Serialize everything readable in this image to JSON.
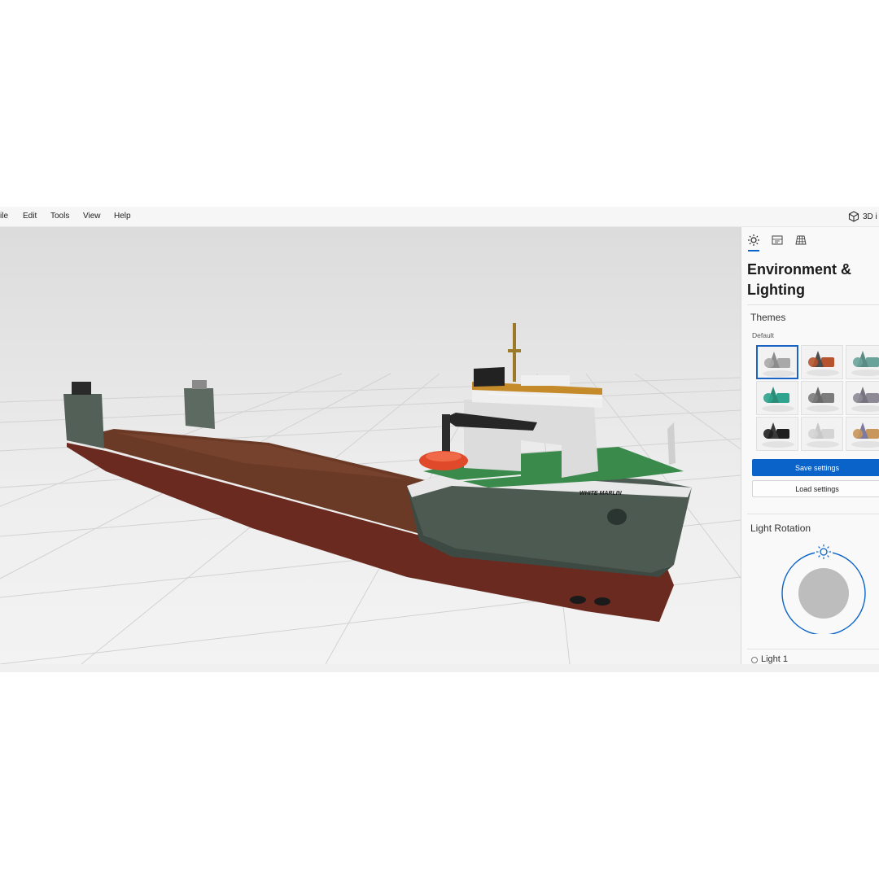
{
  "menu": {
    "items": [
      "ile",
      "Edit",
      "Tools",
      "View",
      "Help"
    ],
    "mode_label": "3D i",
    "mode_icon": "cube-icon"
  },
  "viewport": {
    "hull_name": "WHITE MARLIN"
  },
  "panel": {
    "tabs": [
      {
        "icon": "sun-icon",
        "selected": true
      },
      {
        "icon": "stats-icon",
        "selected": false
      },
      {
        "icon": "grid-icon",
        "selected": false
      }
    ],
    "title": "Environment & Lighting",
    "themes": {
      "heading": "Themes",
      "sublabel": "Default",
      "selected_index": 0,
      "tiles": [
        {
          "bg": "#f2f2f2",
          "shape": "#a9a9a9",
          "accent": "#8c8c8c"
        },
        {
          "bg": "#f2f2f2",
          "shape": "#b5542f",
          "accent": "#4c4c4c"
        },
        {
          "bg": "#f2f2f2",
          "shape": "#6aa39a",
          "accent": "#5a8c84"
        },
        {
          "bg": "#f2f2f2",
          "shape": "#2fa38d",
          "accent": "#2b8a78"
        },
        {
          "bg": "#f2f2f2",
          "shape": "#7c7c7c",
          "accent": "#6a6a6a"
        },
        {
          "bg": "#f2f2f2",
          "shape": "#8d8a96",
          "accent": "#77737f"
        },
        {
          "bg": "#f2f2f2",
          "shape": "#1f1f1f",
          "accent": "#3a3a3a"
        },
        {
          "bg": "#f2f2f2",
          "shape": "#d4d4d4",
          "accent": "#c7c7c7"
        },
        {
          "bg": "#f2f2f2",
          "shape": "#c8965a",
          "accent": "#7d7aa0"
        }
      ]
    },
    "save_label": "Save settings",
    "load_label": "Load settings",
    "rotation_heading": "Light Rotation",
    "light_label": "Light 1"
  },
  "colors": {
    "accent": "#0a63c9",
    "deck": "#6b3a26",
    "hull_lower": "#6a2a1f",
    "hull_upper": "#4c5a52"
  }
}
